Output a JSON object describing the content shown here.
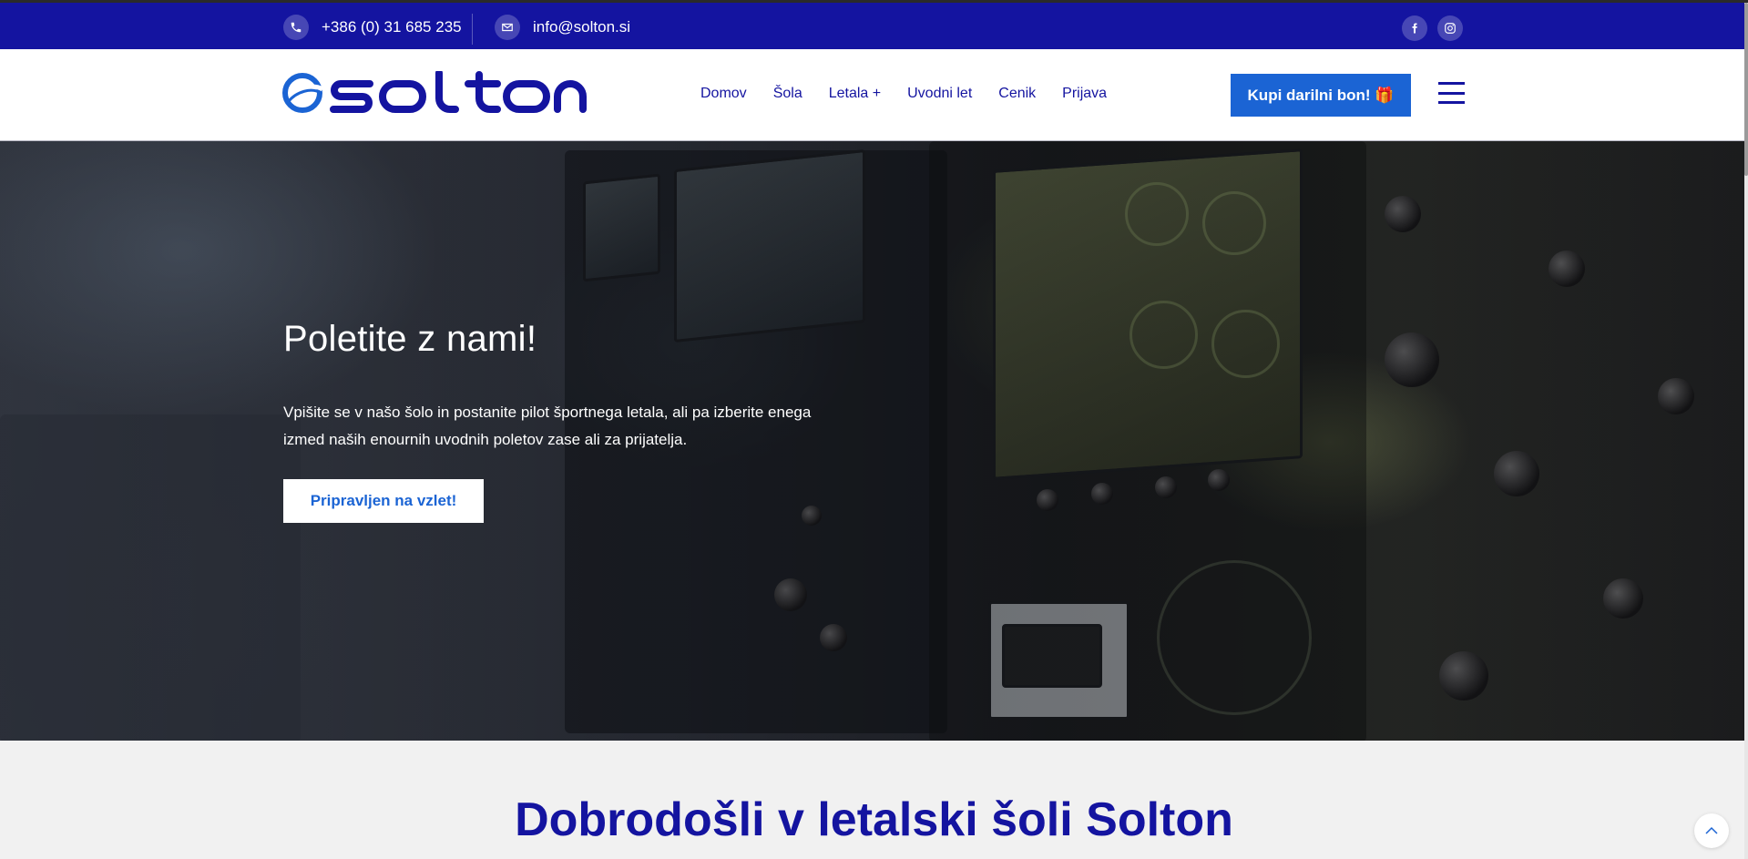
{
  "topbar": {
    "phone": "+386 (0) 31 685 235",
    "email": "info@solton.si",
    "social": [
      {
        "label": "f",
        "icon": "facebook-icon"
      },
      {
        "label": "◎",
        "icon": "instagram-icon"
      }
    ]
  },
  "header": {
    "logo_text": "solton",
    "nav": [
      "Domov",
      "Šola",
      "Letala +",
      "Uvodni let",
      "Cenik",
      "Prijava"
    ],
    "cta_label": "Kupi darilni bon! 🎁"
  },
  "hero": {
    "title": "Poletite z nami!",
    "text": "Vpišite se v našo šolo in postanite pilot športnega letala, ali pa izberite enega izmed naših enournih uvodnih poletov zase ali za prijatelja.",
    "button_label": "Pripravljen na vzlet!"
  },
  "welcome": {
    "title": "Dobrodošli v letalski šoli Solton"
  },
  "colors": {
    "brand_blue": "#1414a0",
    "accent_blue": "#1b64d4"
  }
}
